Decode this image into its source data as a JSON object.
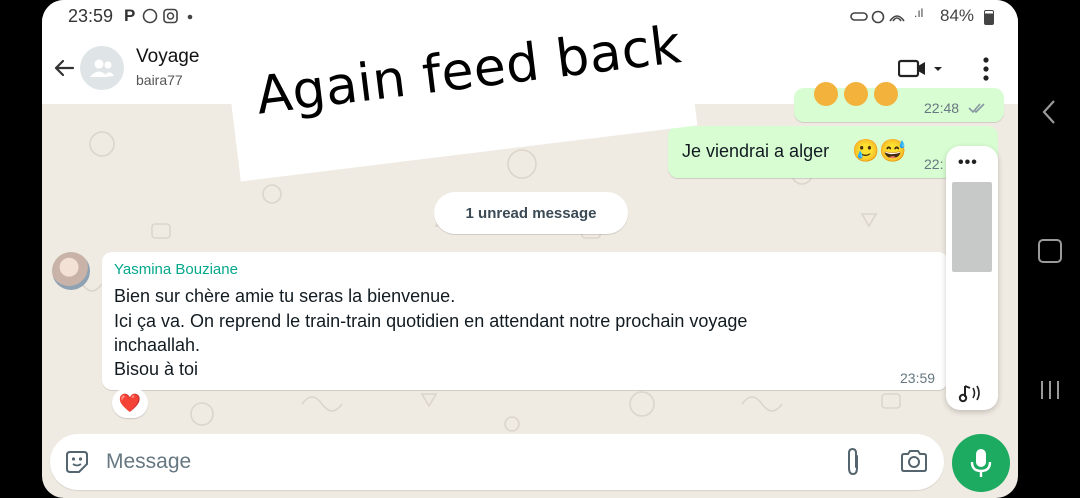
{
  "status_bar": {
    "time": "23:59",
    "battery": "84%"
  },
  "header": {
    "title": "Voyage",
    "subtitle": "baira77"
  },
  "annotation": {
    "text": "Again feed back"
  },
  "messages": {
    "partial_out_time": "22:48",
    "out_message": {
      "text": "Je viendrai a alger",
      "emojis": "🥲😅",
      "time": "22:"
    },
    "unread_label": "1 unread message",
    "in_message": {
      "sender": "Yasmina Bouziane",
      "lines": [
        "Bien sur chère amie tu seras la bienvenue.",
        "Ici ça va. On reprend le train-train quotidien en attendant notre prochain voyage",
        "inchaallah.",
        "Bisou à toi"
      ],
      "time": "23:59",
      "reaction": "❤️"
    }
  },
  "side_panel": {
    "menu": "•••"
  },
  "input": {
    "placeholder": "Message"
  },
  "icons": {
    "back": "arrow-left-icon",
    "video": "video-camera-icon",
    "more": "more-vertical-icon",
    "sticker": "sticker-icon",
    "attach": "paperclip-icon",
    "camera": "camera-icon",
    "mic": "microphone-icon"
  },
  "colors": {
    "out_bubble": "#d9fdd3",
    "sender_name": "#06a88c",
    "mic_button": "#1daa61",
    "chat_bg": "#efeae2"
  }
}
